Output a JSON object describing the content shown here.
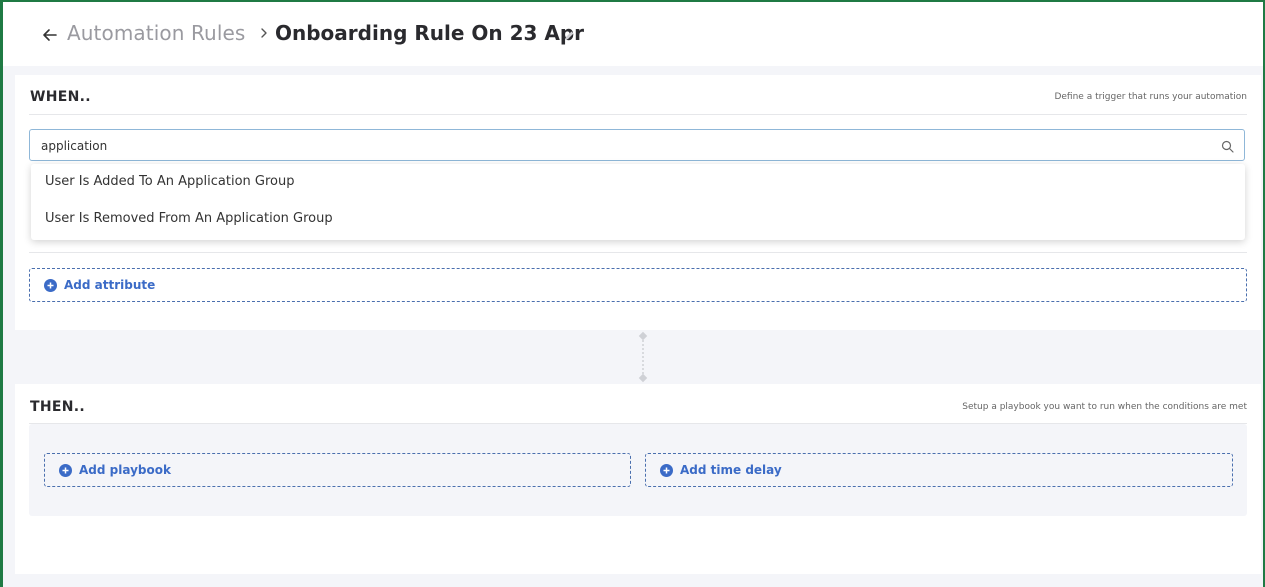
{
  "header": {
    "parent_label": "Automation Rules",
    "current_label": "Onboarding Rule On 23 Apr"
  },
  "when": {
    "title": "WHEN..",
    "hint": "Define a trigger that runs your automation",
    "search_value": "application",
    "dropdown_options": [
      "User Is Added To An Application Group",
      "User Is Removed From An Application Group"
    ],
    "add_attribute_label": "Add attribute"
  },
  "then": {
    "title": "THEN..",
    "hint": "Setup a playbook you want to run when the conditions are met",
    "add_playbook_label": "Add playbook",
    "add_time_delay_label": "Add time delay"
  },
  "colors": {
    "accent": "#3b6bc7",
    "frame_border": "#1f7a44",
    "search_border": "#8fb7d8"
  },
  "icons": [
    "arrow-left-icon",
    "chevron-right-icon",
    "pencil-icon",
    "search-icon",
    "plus-circle-icon",
    "connector-icon"
  ]
}
